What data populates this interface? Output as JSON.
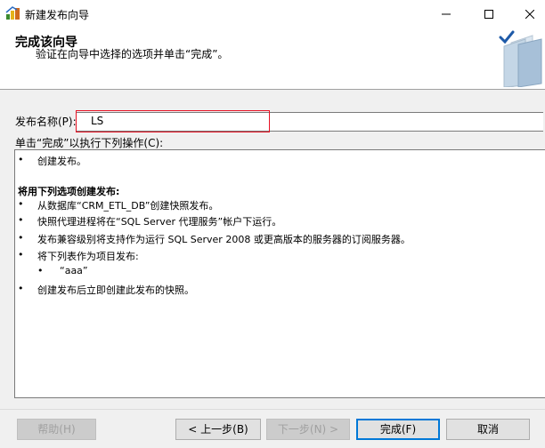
{
  "window": {
    "title": "新建发布向导",
    "minimize_icon": "minimize-icon",
    "maximize_icon": "maximize-icon",
    "close_icon": "close-icon"
  },
  "header": {
    "title": "完成该向导",
    "subtitle": "验证在向导中选择的选项并单击“完成”。",
    "graphic_icon": "wizard-complete-icon"
  },
  "form": {
    "name_label": "发布名称(P):",
    "name_value": "LS",
    "actions_label": "单击“完成”以执行下列操作(C):"
  },
  "summary": {
    "bullet": "•",
    "line1": "创建发布。",
    "section_heading": "将用下列选项创建发布:",
    "line2": "从数据库“CRM_ETL_DB”创建快照发布。",
    "line3": "快照代理进程将在“SQL Server 代理服务”帐户下运行。",
    "line4": "发布兼容级别将支持作为运行 SQL Server 2008 或更高版本的服务器的订阅服务器。",
    "line5": "将下列表作为项目发布:",
    "line6": "“aaa”",
    "line7": "创建发布后立即创建此发布的快照。"
  },
  "buttons": {
    "help": "帮助(H)",
    "back": "< 上一步(B)",
    "next": "下一步(N) >",
    "finish": "完成(F)",
    "cancel": "取消"
  },
  "colors": {
    "highlight_border": "#e81123",
    "primary_button_border": "#0078d7"
  }
}
